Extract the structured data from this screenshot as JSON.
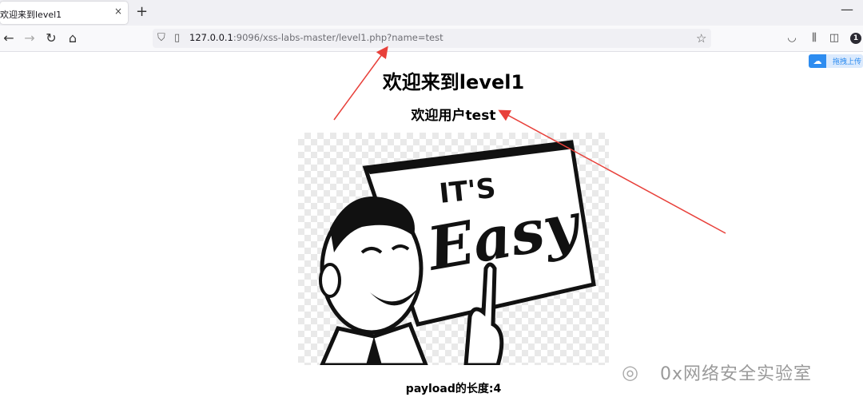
{
  "browser": {
    "tab_title": "欢迎来到level1",
    "tab_close": "×",
    "new_tab": "+",
    "minimize": "—",
    "url_host": "127.0.0.1",
    "url_path": ":9096/xss-labs-master/level1.php?name=test",
    "badge_count": "1"
  },
  "baidu_widget": {
    "label": "拖拽上传"
  },
  "page": {
    "heading": "欢迎来到level1",
    "welcome_user": "欢迎用户test",
    "image_text": "IT'S Easy",
    "payload_length": "payload的长度:4"
  },
  "watermark": {
    "text": "0x网络安全实验室"
  },
  "colors": {
    "arrow": "#e8403a",
    "tab_bg": "#f0f0f4",
    "nav_bg": "#f9f9fb"
  }
}
